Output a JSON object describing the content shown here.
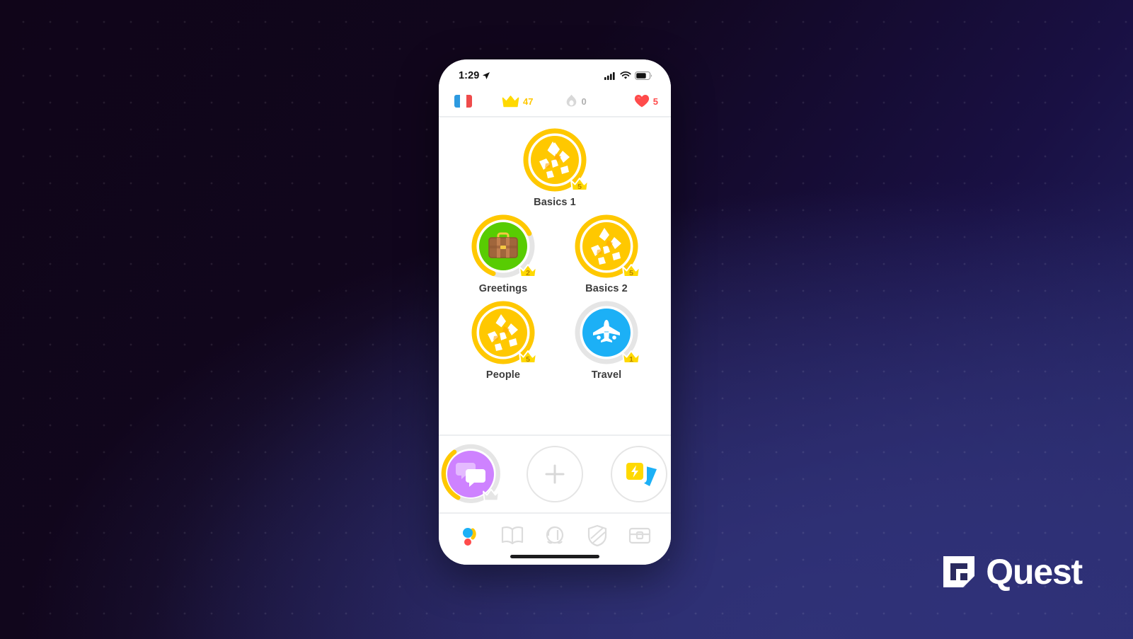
{
  "backdrop": {
    "gradient_from": "#100519",
    "gradient_to": "#2f3178",
    "dot_color": "#ffffff"
  },
  "phone": {
    "status_bar": {
      "time": "1:29",
      "location_icon": "location-arrow-icon",
      "signal_icon": "cellular-signal-icon",
      "wifi_icon": "wifi-icon",
      "battery_icon": "battery-icon"
    },
    "stats_bar": {
      "flag": {
        "icon": "french-flag-icon",
        "label": "French",
        "colors": [
          "#2d9ae0",
          "#ffffff",
          "#ef4b4b"
        ]
      },
      "crown": {
        "icon": "crown-icon",
        "value": "47",
        "color": "#ffc700"
      },
      "streak": {
        "icon": "streak-flame-icon",
        "value": "0",
        "color": "#afafaf"
      },
      "hearts": {
        "icon": "heart-icon",
        "value": "5",
        "color": "#ff4b4b"
      }
    },
    "tree": {
      "rows": [
        [
          {
            "name": "Basics 1",
            "icon": "cracked-egg-icon",
            "disc_color": "#ffc800",
            "ring_color": "#ffc800",
            "ring_progress": 100,
            "crown": "5",
            "state": "complete"
          }
        ],
        [
          {
            "name": "Greetings",
            "icon": "briefcase-icon",
            "disc_color": "#58cc02",
            "ring_color": "#ffc800",
            "ring_progress": 62,
            "crown": "2",
            "state": "in-progress"
          },
          {
            "name": "Basics 2",
            "icon": "cracked-egg-icon",
            "disc_color": "#ffc800",
            "ring_color": "#ffc800",
            "ring_progress": 100,
            "crown": "5",
            "state": "complete"
          }
        ],
        [
          {
            "name": "People",
            "icon": "cracked-egg-icon",
            "disc_color": "#ffc800",
            "ring_color": "#ffc800",
            "ring_progress": 100,
            "crown": "5",
            "state": "complete"
          },
          {
            "name": "Travel",
            "icon": "airplane-icon",
            "disc_color": "#1cb0f6",
            "ring_color": "#e5e5e5",
            "ring_progress": 0,
            "crown": "1",
            "state": "locked-ring"
          }
        ]
      ]
    },
    "action_row": {
      "items": [
        {
          "name": "Phrases",
          "icon": "chat-bubbles-icon",
          "disc_color": "#ce82ff",
          "ring_color": "#ffc800",
          "ring_progress": 30,
          "state": "in-progress"
        },
        {
          "name": "Add skill",
          "icon": "plus-icon",
          "state": "empty"
        },
        {
          "name": "Practice flashcards",
          "icon": "flashcards-bolt-icon",
          "card_front_color": "#ffd900",
          "card_back_color": "#1cb0f6",
          "state": "available"
        }
      ]
    },
    "bottom_nav": {
      "items": [
        {
          "name": "learn-tab",
          "icon": "duo-dots-icon",
          "active": true
        },
        {
          "name": "stories-tab",
          "icon": "book-icon",
          "active": false
        },
        {
          "name": "profile-tab",
          "icon": "character-head-icon",
          "active": false
        },
        {
          "name": "leagues-tab",
          "icon": "shield-icon",
          "active": false
        },
        {
          "name": "shop-tab",
          "icon": "treasure-chest-icon",
          "active": false
        }
      ]
    },
    "home_indicator": "home-indicator-bar"
  },
  "watermark": {
    "brand": "Quest",
    "mark_icon": "quest-logo-mark"
  }
}
